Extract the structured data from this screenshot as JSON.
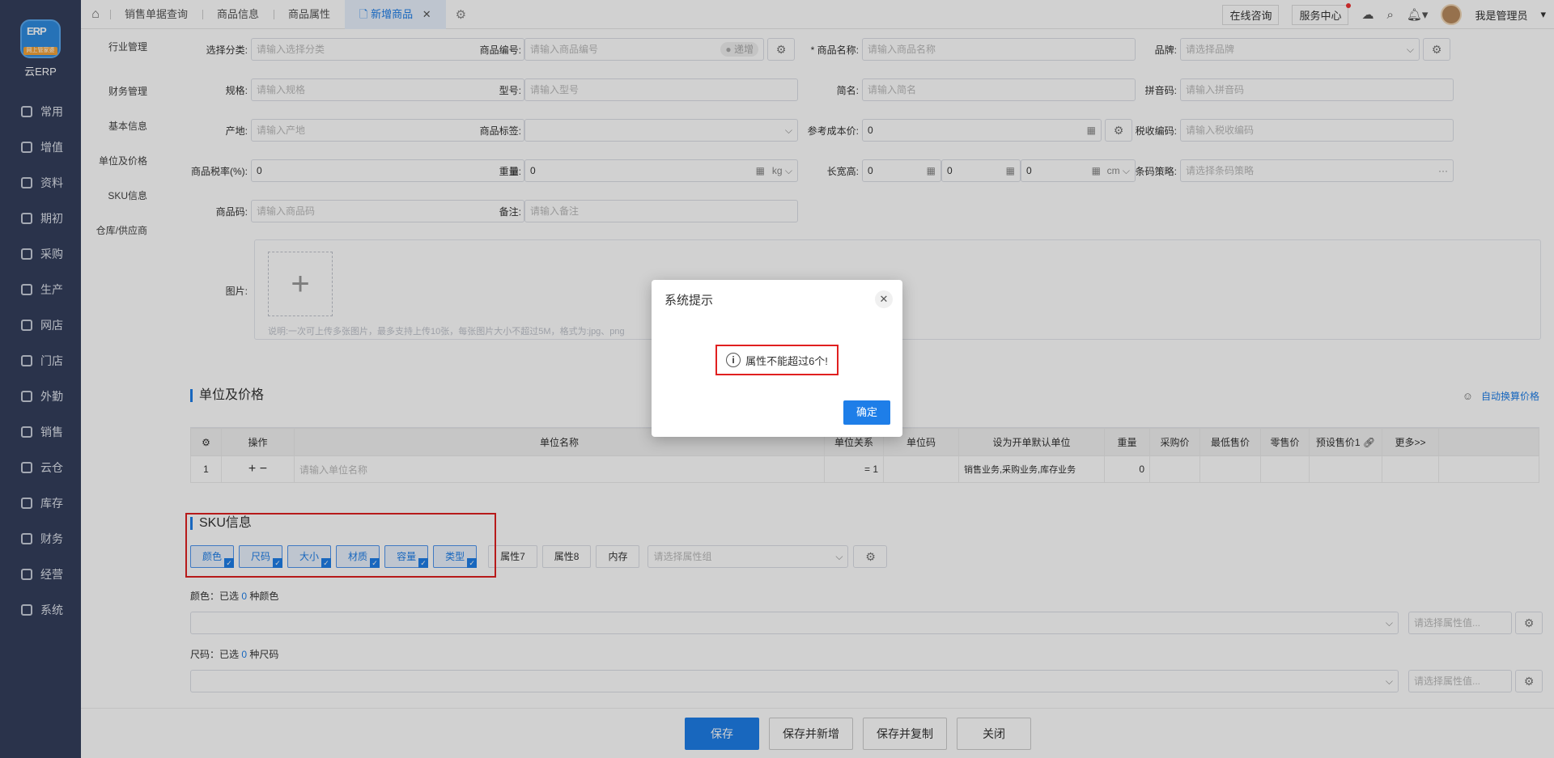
{
  "app": {
    "name": "云ERP",
    "logo_text": "ERP",
    "logo_band": "网上管家婆"
  },
  "sidebar": {
    "items": [
      {
        "label": "常用",
        "icon": "star-icon"
      },
      {
        "label": "增值",
        "icon": "plus-box-icon"
      },
      {
        "label": "资料",
        "icon": "doc-icon"
      },
      {
        "label": "期初",
        "icon": "clock-icon"
      },
      {
        "label": "采购",
        "icon": "cart-icon"
      },
      {
        "label": "生产",
        "icon": "factory-icon"
      },
      {
        "label": "网店",
        "icon": "shop-icon"
      },
      {
        "label": "门店",
        "icon": "store-icon"
      },
      {
        "label": "外勤",
        "icon": "field-icon"
      },
      {
        "label": "销售",
        "icon": "sales-icon"
      },
      {
        "label": "云仓",
        "icon": "cloud-warehouse-icon"
      },
      {
        "label": "库存",
        "icon": "inventory-icon"
      },
      {
        "label": "财务",
        "icon": "finance-icon"
      },
      {
        "label": "经营",
        "icon": "chart-icon"
      },
      {
        "label": "系统",
        "icon": "gear-icon"
      }
    ]
  },
  "topbar": {
    "tabs": [
      "销售单据查询",
      "商品信息",
      "商品属性"
    ],
    "active_tab": "新增商品",
    "consult": "在线咨询",
    "service": "服务中心",
    "user": "我是管理员"
  },
  "anchors": [
    "行业管理",
    "财务管理",
    "基本信息",
    "单位及价格",
    "SKU信息",
    "仓库/供应商"
  ],
  "form": {
    "category": {
      "label": "选择分类:",
      "placeholder": "请输入选择分类"
    },
    "code": {
      "label": "商品编号:",
      "placeholder": "请输入商品编号",
      "tag": "● 递增"
    },
    "name": {
      "label": "* 商品名称:",
      "placeholder": "请输入商品名称"
    },
    "brand": {
      "label": "品牌:",
      "placeholder": "请选择品牌"
    },
    "spec": {
      "label": "规格:",
      "placeholder": "请输入规格"
    },
    "model": {
      "label": "型号:",
      "placeholder": "请输入型号"
    },
    "short": {
      "label": "简名:",
      "placeholder": "请输入简名"
    },
    "pinyin": {
      "label": "拼音码:",
      "placeholder": "请输入拼音码"
    },
    "origin": {
      "label": "产地:",
      "placeholder": "请输入产地"
    },
    "tags": {
      "label": "商品标签:",
      "placeholder": ""
    },
    "cost": {
      "label": "参考成本价:",
      "value": "0"
    },
    "taxcode": {
      "label": "税收编码:",
      "placeholder": "请输入税收编码"
    },
    "taxrate": {
      "label": "商品税率(%):",
      "value": "0"
    },
    "weight": {
      "label": "重量:",
      "value": "0",
      "unit": "kg"
    },
    "dims": {
      "label": "长宽高:",
      "l": "0",
      "w": "0",
      "h": "0",
      "unit": "cm"
    },
    "barcode_policy": {
      "label": "条码策略:",
      "placeholder": "请选择条码策略"
    },
    "goods_code": {
      "label": "商品码:",
      "placeholder": "请输入商品码"
    },
    "remark": {
      "label": "备注:",
      "placeholder": "请输入备注"
    },
    "image": {
      "label": "图片:",
      "hint": "说明:一次可上传多张图片，最多支持上传10张，每张图片大小不超过5M，格式为:jpg、png"
    }
  },
  "unit_section": {
    "title": "单位及价格",
    "auto_price": "自动换算价格",
    "headers": [
      "操作",
      "单位名称",
      "单位关系",
      "单位码",
      "设为开单默认单位",
      "重量",
      "采购价",
      "最低售价",
      "零售价",
      "预设售价1",
      "更多>>"
    ],
    "row": {
      "index": "1",
      "ops": "+ −",
      "name_placeholder": "请输入单位名称",
      "relation": "= 1",
      "default_unit": "销售业务,采购业务,库存业务",
      "weight": "0"
    }
  },
  "sku_section": {
    "title": "SKU信息",
    "selected_attrs": [
      "颜色",
      "尺码",
      "大小",
      "材质",
      "容量",
      "类型"
    ],
    "other_attrs": [
      "属性7",
      "属性8",
      "内存"
    ],
    "attr_group_placeholder": "请选择属性组",
    "color_line": {
      "prefix": "颜色：已选 ",
      "count": "0",
      "suffix": " 种颜色"
    },
    "size_line": {
      "prefix": "尺码：已选 ",
      "count": "0",
      "suffix": " 种尺码"
    },
    "value_placeholder": "请选择属性值..."
  },
  "footer": {
    "save": "保存",
    "save_new": "保存并新增",
    "save_copy": "保存并复制",
    "close": "关闭"
  },
  "modal": {
    "title": "系统提示",
    "message": "属性不能超过6个!",
    "ok": "确定"
  }
}
